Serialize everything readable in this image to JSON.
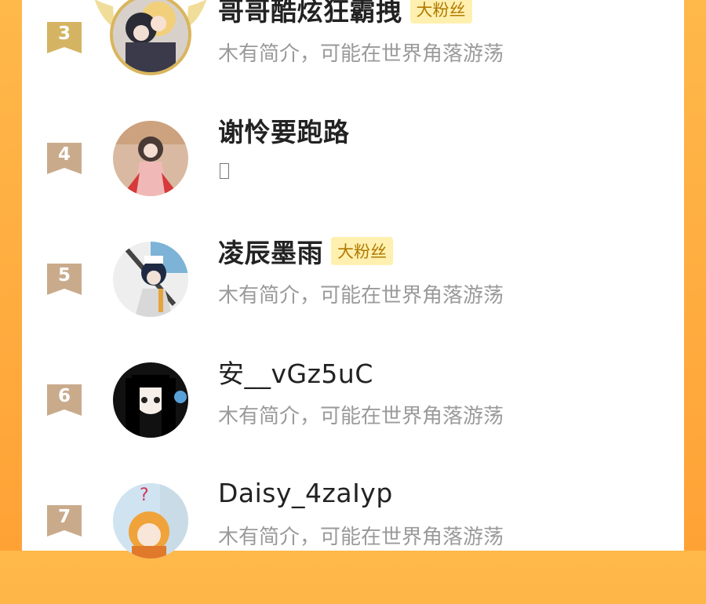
{
  "list": {
    "users": [
      {
        "rank": "3",
        "name": "哥哥酷炫狂霸拽",
        "badge": "大粉丝",
        "bio": "木有简介，可能在世界角落游荡",
        "rank_color": "#d4b463",
        "crown": true
      },
      {
        "rank": "4",
        "name": "谢怜要跑路",
        "badge": "",
        "bio": "",
        "rank_color": "#c9ab8c",
        "crown": false
      },
      {
        "rank": "5",
        "name": "凌辰墨雨",
        "badge": "大粉丝",
        "bio": "木有简介，可能在世界角落游荡",
        "rank_color": "#c9ab8c",
        "crown": false
      },
      {
        "rank": "6",
        "name": "安__vGz5uC",
        "badge": "",
        "bio": "木有简介，可能在世界角落游荡",
        "rank_color": "#c9ab8c",
        "crown": false
      },
      {
        "rank": "7",
        "name": "Daisy_4zaIyp",
        "badge": "",
        "bio": "木有简介，可能在世界角落游荡",
        "rank_color": "#c9ab8c",
        "crown": false
      }
    ]
  },
  "colors": {
    "background": "#ffa236",
    "panel": "#ffffff",
    "name_text": "#222222",
    "bio_text": "#9a9a9a",
    "badge_bg": "#fff0b0",
    "badge_text": "#b07a00"
  }
}
